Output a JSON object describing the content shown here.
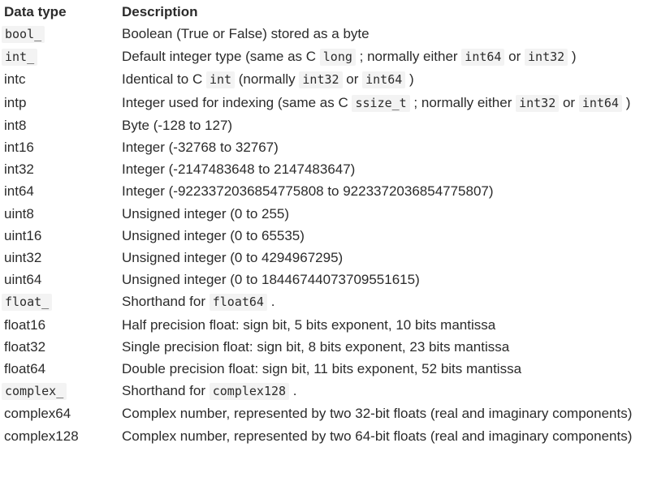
{
  "header": {
    "type": "Data type",
    "description": "Description"
  },
  "rows": [
    {
      "type": "bool_",
      "type_code": true,
      "desc": [
        "Boolean (True or False) stored as a byte"
      ]
    },
    {
      "type": "int_",
      "type_code": true,
      "desc": [
        "Default integer type (same as C ",
        {
          "code": "long"
        },
        " ; normally either ",
        {
          "code": "int64"
        },
        " or ",
        {
          "code": "int32"
        },
        " )"
      ]
    },
    {
      "type": "intc",
      "type_code": false,
      "desc": [
        "Identical to C ",
        {
          "code": "int"
        },
        " (normally ",
        {
          "code": "int32"
        },
        " or ",
        {
          "code": "int64"
        },
        " )"
      ]
    },
    {
      "type": "intp",
      "type_code": false,
      "desc": [
        "Integer used for indexing (same as C ",
        {
          "code": "ssize_t"
        },
        " ; normally either ",
        {
          "code": "int32"
        },
        " or ",
        {
          "code": "int64"
        },
        " )"
      ]
    },
    {
      "type": "int8",
      "type_code": false,
      "desc": [
        "Byte (-128 to 127)"
      ]
    },
    {
      "type": "int16",
      "type_code": false,
      "desc": [
        "Integer (-32768 to 32767)"
      ]
    },
    {
      "type": "int32",
      "type_code": false,
      "desc": [
        "Integer (-2147483648 to 2147483647)"
      ]
    },
    {
      "type": "int64",
      "type_code": false,
      "desc": [
        "Integer (-9223372036854775808 to 9223372036854775807)"
      ]
    },
    {
      "type": "uint8",
      "type_code": false,
      "desc": [
        "Unsigned integer (0 to 255)"
      ]
    },
    {
      "type": "uint16",
      "type_code": false,
      "desc": [
        "Unsigned integer (0 to 65535)"
      ]
    },
    {
      "type": "uint32",
      "type_code": false,
      "desc": [
        "Unsigned integer (0 to 4294967295)"
      ]
    },
    {
      "type": "uint64",
      "type_code": false,
      "desc": [
        "Unsigned integer (0 to 18446744073709551615)"
      ]
    },
    {
      "type": "float_",
      "type_code": true,
      "desc": [
        "Shorthand for ",
        {
          "code": "float64"
        },
        " ."
      ]
    },
    {
      "type": "float16",
      "type_code": false,
      "desc": [
        "Half precision float: sign bit, 5 bits exponent, 10 bits mantissa"
      ]
    },
    {
      "type": "float32",
      "type_code": false,
      "desc": [
        "Single precision float: sign bit, 8 bits exponent, 23 bits mantissa"
      ]
    },
    {
      "type": "float64",
      "type_code": false,
      "desc": [
        "Double precision float: sign bit, 11 bits exponent, 52 bits mantissa"
      ]
    },
    {
      "type": "complex_",
      "type_code": true,
      "desc": [
        "Shorthand for ",
        {
          "code": "complex128"
        },
        " ."
      ]
    },
    {
      "type": "complex64",
      "type_code": false,
      "desc": [
        "Complex number, represented by two 32-bit floats (real and imaginary components)"
      ]
    },
    {
      "type": "complex128",
      "type_code": false,
      "desc": [
        "Complex number, represented by two 64-bit floats (real and imaginary components)"
      ]
    }
  ]
}
